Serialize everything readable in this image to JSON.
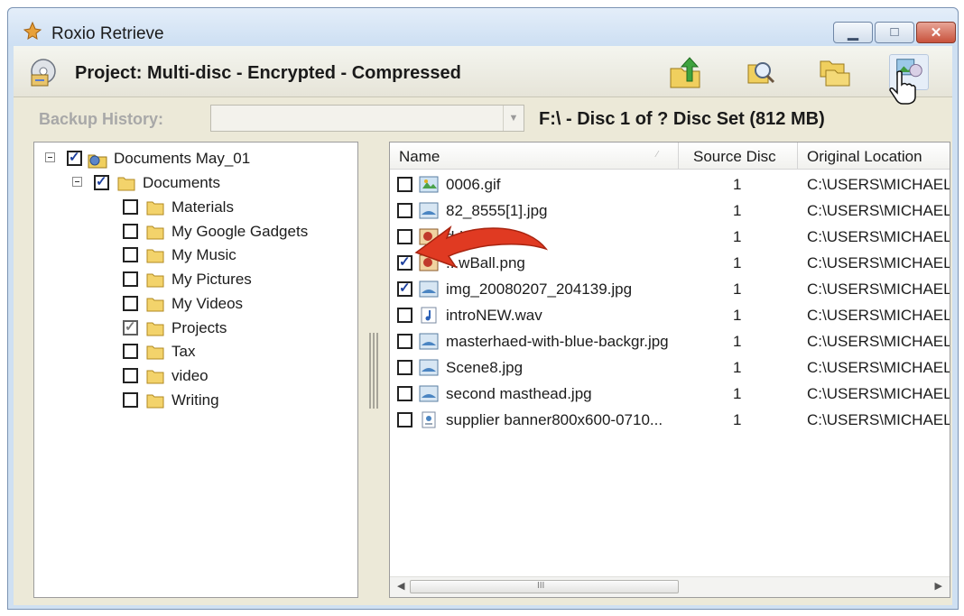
{
  "window": {
    "title": "Roxio Retrieve",
    "minimize": "▁",
    "maximize": "□",
    "close": "✕"
  },
  "header": {
    "project_title": "Project: Multi-disc - Encrypted - Compressed",
    "icons": [
      "project-icon",
      "restore-up-icon",
      "search-icon",
      "copy-folder-icon",
      "view-image-icon"
    ]
  },
  "history": {
    "label": "Backup History:",
    "value": "",
    "disc_info": "F:\\ - Disc 1 of ? Disc Set (812 MB)"
  },
  "tree": {
    "items": [
      {
        "label": "Documents May_01",
        "level": 0,
        "state": "checked"
      },
      {
        "label": "Documents",
        "level": 1,
        "state": "checked"
      },
      {
        "label": "Materials",
        "level": 2,
        "state": "unchecked"
      },
      {
        "label": "My Google Gadgets",
        "level": 2,
        "state": "unchecked"
      },
      {
        "label": "My Music",
        "level": 2,
        "state": "unchecked"
      },
      {
        "label": "My Pictures",
        "level": 2,
        "state": "unchecked"
      },
      {
        "label": "My Videos",
        "level": 2,
        "state": "unchecked"
      },
      {
        "label": "Projects",
        "level": 2,
        "state": "partial"
      },
      {
        "label": "Tax",
        "level": 2,
        "state": "unchecked"
      },
      {
        "label": "video",
        "level": 2,
        "state": "unchecked"
      },
      {
        "label": "Writing",
        "level": 2,
        "state": "unchecked"
      }
    ]
  },
  "list": {
    "columns": [
      "Name",
      "Source Disc",
      "Original Location"
    ],
    "rows": [
      {
        "name": "0006.gif",
        "source": "1",
        "location": "C:\\USERS\\MICHAEL",
        "checked": false,
        "icon": "gif-file-icon"
      },
      {
        "name": "82_8555[1].jpg",
        "source": "1",
        "location": "C:\\USERS\\MICHAEL",
        "checked": false,
        "icon": "image-file-icon"
      },
      {
        "name": "ddw",
        "source": "1",
        "location": "C:\\USERS\\MICHAEL",
        "checked": false,
        "icon": "image-file-icon"
      },
      {
        "name": "...wBall.png",
        "source": "1",
        "location": "C:\\USERS\\MICHAEL",
        "checked": true,
        "icon": "image-file-icon"
      },
      {
        "name": "img_20080207_204139.jpg",
        "source": "1",
        "location": "C:\\USERS\\MICHAEL",
        "checked": true,
        "icon": "image-file-icon"
      },
      {
        "name": "introNEW.wav",
        "source": "1",
        "location": "C:\\USERS\\MICHAEL",
        "checked": false,
        "icon": "audio-file-icon"
      },
      {
        "name": "masterhaed-with-blue-backgr.jpg",
        "source": "1",
        "location": "C:\\USERS\\MICHAEL",
        "checked": false,
        "icon": "image-file-icon"
      },
      {
        "name": "Scene8.jpg",
        "source": "1",
        "location": "C:\\USERS\\MICHAEL",
        "checked": false,
        "icon": "image-file-icon"
      },
      {
        "name": "second masthead.jpg",
        "source": "1",
        "location": "C:\\USERS\\MICHAEL",
        "checked": false,
        "icon": "image-file-icon"
      },
      {
        "name": "supplier banner800x600-0710...",
        "source": "1",
        "location": "C:\\USERS\\MICHAEL",
        "checked": false,
        "icon": "generic-file-icon"
      }
    ],
    "scroll_thumb": "III"
  },
  "colors": {
    "accent_arrow": "#e03a22",
    "window_frame": "#cfe0f2",
    "panel_bg": "#ece9d8"
  }
}
